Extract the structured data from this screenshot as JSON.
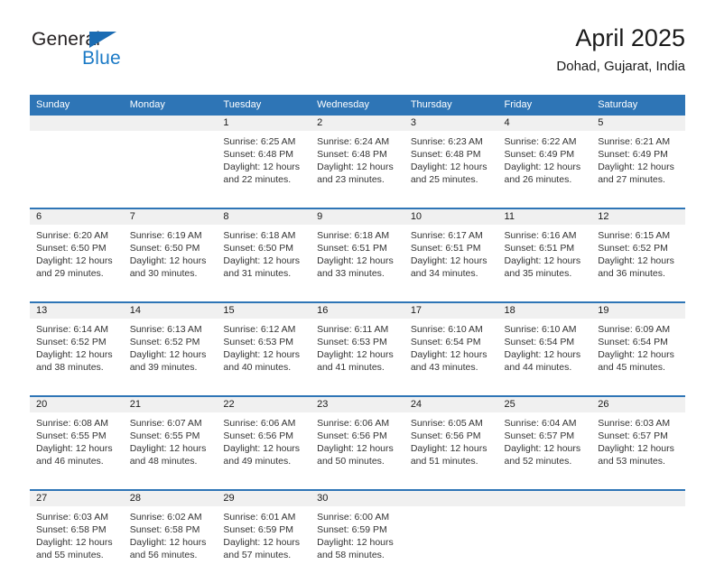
{
  "brand": {
    "name_top": "General",
    "name_bottom": "Blue",
    "triangle_color": "#1b6cb3",
    "blue_text_color": "#1b7ac6"
  },
  "header": {
    "title": "April 2025",
    "subtitle": "Dohad, Gujarat, India"
  },
  "theme": {
    "header_blue": "#2e75b6",
    "band_gray": "#f0f0f0",
    "text_dark": "#1a1a1a"
  },
  "weekdays": [
    "Sunday",
    "Monday",
    "Tuesday",
    "Wednesday",
    "Thursday",
    "Friday",
    "Saturday"
  ],
  "weeks": [
    [
      {
        "empty": true
      },
      {
        "empty": true
      },
      {
        "day": "1",
        "sunrise": "Sunrise: 6:25 AM",
        "sunset": "Sunset: 6:48 PM",
        "daylight1": "Daylight: 12 hours",
        "daylight2": "and 22 minutes."
      },
      {
        "day": "2",
        "sunrise": "Sunrise: 6:24 AM",
        "sunset": "Sunset: 6:48 PM",
        "daylight1": "Daylight: 12 hours",
        "daylight2": "and 23 minutes."
      },
      {
        "day": "3",
        "sunrise": "Sunrise: 6:23 AM",
        "sunset": "Sunset: 6:48 PM",
        "daylight1": "Daylight: 12 hours",
        "daylight2": "and 25 minutes."
      },
      {
        "day": "4",
        "sunrise": "Sunrise: 6:22 AM",
        "sunset": "Sunset: 6:49 PM",
        "daylight1": "Daylight: 12 hours",
        "daylight2": "and 26 minutes."
      },
      {
        "day": "5",
        "sunrise": "Sunrise: 6:21 AM",
        "sunset": "Sunset: 6:49 PM",
        "daylight1": "Daylight: 12 hours",
        "daylight2": "and 27 minutes."
      }
    ],
    [
      {
        "day": "6",
        "sunrise": "Sunrise: 6:20 AM",
        "sunset": "Sunset: 6:50 PM",
        "daylight1": "Daylight: 12 hours",
        "daylight2": "and 29 minutes."
      },
      {
        "day": "7",
        "sunrise": "Sunrise: 6:19 AM",
        "sunset": "Sunset: 6:50 PM",
        "daylight1": "Daylight: 12 hours",
        "daylight2": "and 30 minutes."
      },
      {
        "day": "8",
        "sunrise": "Sunrise: 6:18 AM",
        "sunset": "Sunset: 6:50 PM",
        "daylight1": "Daylight: 12 hours",
        "daylight2": "and 31 minutes."
      },
      {
        "day": "9",
        "sunrise": "Sunrise: 6:18 AM",
        "sunset": "Sunset: 6:51 PM",
        "daylight1": "Daylight: 12 hours",
        "daylight2": "and 33 minutes."
      },
      {
        "day": "10",
        "sunrise": "Sunrise: 6:17 AM",
        "sunset": "Sunset: 6:51 PM",
        "daylight1": "Daylight: 12 hours",
        "daylight2": "and 34 minutes."
      },
      {
        "day": "11",
        "sunrise": "Sunrise: 6:16 AM",
        "sunset": "Sunset: 6:51 PM",
        "daylight1": "Daylight: 12 hours",
        "daylight2": "and 35 minutes."
      },
      {
        "day": "12",
        "sunrise": "Sunrise: 6:15 AM",
        "sunset": "Sunset: 6:52 PM",
        "daylight1": "Daylight: 12 hours",
        "daylight2": "and 36 minutes."
      }
    ],
    [
      {
        "day": "13",
        "sunrise": "Sunrise: 6:14 AM",
        "sunset": "Sunset: 6:52 PM",
        "daylight1": "Daylight: 12 hours",
        "daylight2": "and 38 minutes."
      },
      {
        "day": "14",
        "sunrise": "Sunrise: 6:13 AM",
        "sunset": "Sunset: 6:52 PM",
        "daylight1": "Daylight: 12 hours",
        "daylight2": "and 39 minutes."
      },
      {
        "day": "15",
        "sunrise": "Sunrise: 6:12 AM",
        "sunset": "Sunset: 6:53 PM",
        "daylight1": "Daylight: 12 hours",
        "daylight2": "and 40 minutes."
      },
      {
        "day": "16",
        "sunrise": "Sunrise: 6:11 AM",
        "sunset": "Sunset: 6:53 PM",
        "daylight1": "Daylight: 12 hours",
        "daylight2": "and 41 minutes."
      },
      {
        "day": "17",
        "sunrise": "Sunrise: 6:10 AM",
        "sunset": "Sunset: 6:54 PM",
        "daylight1": "Daylight: 12 hours",
        "daylight2": "and 43 minutes."
      },
      {
        "day": "18",
        "sunrise": "Sunrise: 6:10 AM",
        "sunset": "Sunset: 6:54 PM",
        "daylight1": "Daylight: 12 hours",
        "daylight2": "and 44 minutes."
      },
      {
        "day": "19",
        "sunrise": "Sunrise: 6:09 AM",
        "sunset": "Sunset: 6:54 PM",
        "daylight1": "Daylight: 12 hours",
        "daylight2": "and 45 minutes."
      }
    ],
    [
      {
        "day": "20",
        "sunrise": "Sunrise: 6:08 AM",
        "sunset": "Sunset: 6:55 PM",
        "daylight1": "Daylight: 12 hours",
        "daylight2": "and 46 minutes."
      },
      {
        "day": "21",
        "sunrise": "Sunrise: 6:07 AM",
        "sunset": "Sunset: 6:55 PM",
        "daylight1": "Daylight: 12 hours",
        "daylight2": "and 48 minutes."
      },
      {
        "day": "22",
        "sunrise": "Sunrise: 6:06 AM",
        "sunset": "Sunset: 6:56 PM",
        "daylight1": "Daylight: 12 hours",
        "daylight2": "and 49 minutes."
      },
      {
        "day": "23",
        "sunrise": "Sunrise: 6:06 AM",
        "sunset": "Sunset: 6:56 PM",
        "daylight1": "Daylight: 12 hours",
        "daylight2": "and 50 minutes."
      },
      {
        "day": "24",
        "sunrise": "Sunrise: 6:05 AM",
        "sunset": "Sunset: 6:56 PM",
        "daylight1": "Daylight: 12 hours",
        "daylight2": "and 51 minutes."
      },
      {
        "day": "25",
        "sunrise": "Sunrise: 6:04 AM",
        "sunset": "Sunset: 6:57 PM",
        "daylight1": "Daylight: 12 hours",
        "daylight2": "and 52 minutes."
      },
      {
        "day": "26",
        "sunrise": "Sunrise: 6:03 AM",
        "sunset": "Sunset: 6:57 PM",
        "daylight1": "Daylight: 12 hours",
        "daylight2": "and 53 minutes."
      }
    ],
    [
      {
        "day": "27",
        "sunrise": "Sunrise: 6:03 AM",
        "sunset": "Sunset: 6:58 PM",
        "daylight1": "Daylight: 12 hours",
        "daylight2": "and 55 minutes."
      },
      {
        "day": "28",
        "sunrise": "Sunrise: 6:02 AM",
        "sunset": "Sunset: 6:58 PM",
        "daylight1": "Daylight: 12 hours",
        "daylight2": "and 56 minutes."
      },
      {
        "day": "29",
        "sunrise": "Sunrise: 6:01 AM",
        "sunset": "Sunset: 6:59 PM",
        "daylight1": "Daylight: 12 hours",
        "daylight2": "and 57 minutes."
      },
      {
        "day": "30",
        "sunrise": "Sunrise: 6:00 AM",
        "sunset": "Sunset: 6:59 PM",
        "daylight1": "Daylight: 12 hours",
        "daylight2": "and 58 minutes."
      },
      {
        "empty": true
      },
      {
        "empty": true
      },
      {
        "empty": true
      }
    ]
  ]
}
